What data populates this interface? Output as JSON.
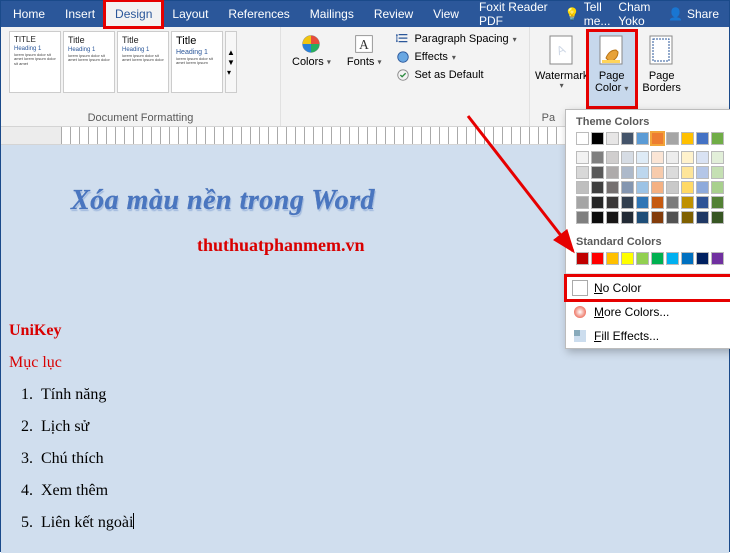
{
  "tabs": {
    "items": [
      "Home",
      "Insert",
      "Design",
      "Layout",
      "References",
      "Mailings",
      "Review",
      "View",
      "Foxit Reader PDF"
    ],
    "active_index": 2,
    "tell_me": "Tell me...",
    "user": "Cham Yoko",
    "share": "Share"
  },
  "ribbon": {
    "doc_format_label": "Document Formatting",
    "themes_preview": {
      "title_label": "TITLE",
      "title_label_big": "Title",
      "heading_label": "Heading 1"
    },
    "colors": "Colors",
    "fonts": "Fonts",
    "paragraph_spacing": "Paragraph Spacing",
    "effects": "Effects",
    "set_default": "Set as Default",
    "watermark": "Watermark",
    "page_color": "Page Color",
    "page_borders": "Page Borders",
    "page_bg_label": "Pa"
  },
  "popup": {
    "theme_colors": "Theme Colors",
    "standard_colors": "Standard Colors",
    "no_color": "No Color",
    "more_colors": "More Colors...",
    "fill_effects": "Fill Effects...",
    "theme_palette_row0": [
      "#ffffff",
      "#000000",
      "#e7e6e6",
      "#44546a",
      "#5b9bd5",
      "#ed7d31",
      "#a5a5a5",
      "#ffc000",
      "#4472c4",
      "#70ad47"
    ],
    "theme_palette_shades": [
      [
        "#f2f2f2",
        "#7f7f7f",
        "#d0cece",
        "#d6dce4",
        "#deebf6",
        "#fbe5d5",
        "#ededed",
        "#fff2cc",
        "#d9e2f3",
        "#e2efd9"
      ],
      [
        "#d8d8d8",
        "#595959",
        "#aeabab",
        "#adb9ca",
        "#bdd7ee",
        "#f7cbac",
        "#dbdbdb",
        "#fee599",
        "#b4c6e7",
        "#c5e0b3"
      ],
      [
        "#bfbfbf",
        "#3f3f3f",
        "#757070",
        "#8496b0",
        "#9cc3e5",
        "#f4b183",
        "#c9c9c9",
        "#ffd965",
        "#8eaadb",
        "#a8d08d"
      ],
      [
        "#a5a5a5",
        "#262626",
        "#3a3838",
        "#323f4f",
        "#2e75b5",
        "#c55a11",
        "#7b7b7b",
        "#bf9000",
        "#2f5496",
        "#538135"
      ],
      [
        "#7f7f7f",
        "#0c0c0c",
        "#171616",
        "#222a35",
        "#1e4e79",
        "#833c0b",
        "#525252",
        "#7f6000",
        "#1f3864",
        "#375623"
      ]
    ],
    "standard_palette": [
      "#c00000",
      "#ff0000",
      "#ffc000",
      "#ffff00",
      "#92d050",
      "#00b050",
      "#00b0f0",
      "#0070c0",
      "#002060",
      "#7030a0"
    ]
  },
  "document": {
    "wordart": "Xóa màu nền trong Word",
    "url": "thuthuatphanmem.vn",
    "t1": "UniKey",
    "t2": "Mục lục",
    "list": [
      "Tính năng",
      "Lịch sử",
      "Chú thích",
      "Xem thêm",
      "Liên kết ngoài"
    ]
  }
}
